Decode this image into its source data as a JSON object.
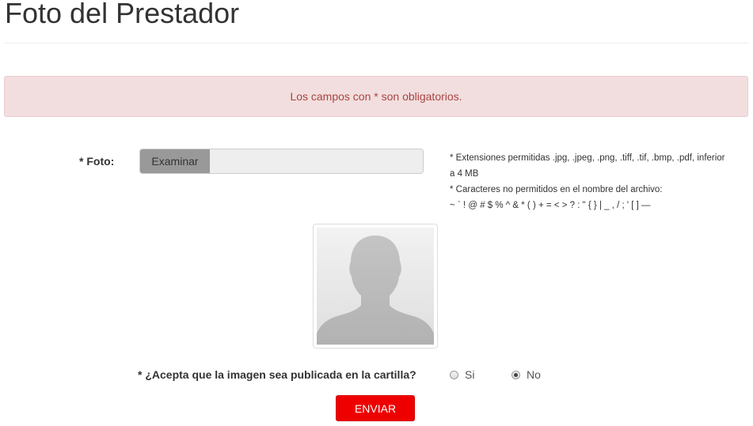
{
  "page": {
    "title": "Foto del Prestador"
  },
  "alert": {
    "message": "Los campos con * son obligatorios.",
    "colors": {
      "background": "#f2dede",
      "border": "#ebccd1",
      "text": "#a94442"
    }
  },
  "form": {
    "foto": {
      "label": "* Foto:",
      "browse_label": "Examinar",
      "file_name": ""
    },
    "help": {
      "extensions": "* Extensiones permitidas .jpg, .jpeg, .png, .tiff, .tif, .bmp, .pdf, inferior a 4 MB",
      "forbidden_title": "* Caracteres no permitidos en el nombre del archivo:",
      "forbidden_chars": "~ ` ! @ # $ % ^ & * ( ) + = < > ? : \" { } | _ , / ; ' [ ] —"
    },
    "photo": {
      "icon": "avatar-placeholder-icon"
    },
    "publish": {
      "question": "* ¿Acepta que la imagen sea publicada en la cartilla?",
      "options": [
        {
          "label": "Si",
          "selected": false
        },
        {
          "label": "No",
          "selected": true
        }
      ]
    },
    "submit_label": "ENVIAR"
  },
  "colors": {
    "accent": "#ee0000",
    "browse_button": "#999999"
  }
}
